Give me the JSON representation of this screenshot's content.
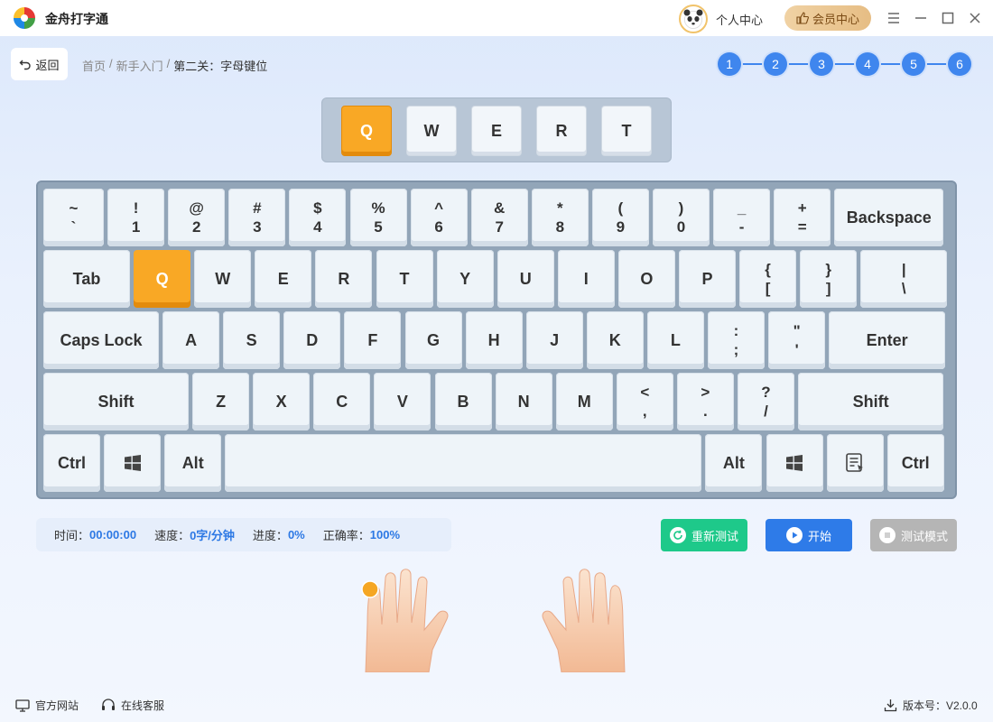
{
  "app": {
    "title": "金舟打字通"
  },
  "header": {
    "personal_center": "个人中心",
    "vip_center": "会员中心"
  },
  "nav": {
    "back_label": "返回",
    "breadcrumb": [
      "首页",
      "新手入门",
      "第二关：字母键位"
    ],
    "separator": "/"
  },
  "steps": [
    "1",
    "2",
    "3",
    "4",
    "5",
    "6"
  ],
  "target_keys": [
    {
      "label": "Q",
      "active": true
    },
    {
      "label": "W",
      "active": false
    },
    {
      "label": "E",
      "active": false
    },
    {
      "label": "R",
      "active": false
    },
    {
      "label": "T",
      "active": false
    }
  ],
  "keyboard": {
    "rows": [
      [
        {
          "top": "~",
          "bot": "`"
        },
        {
          "top": "!",
          "bot": "1"
        },
        {
          "top": "@",
          "bot": "2"
        },
        {
          "top": "#",
          "bot": "3"
        },
        {
          "top": "$",
          "bot": "4"
        },
        {
          "top": "%",
          "bot": "5"
        },
        {
          "top": "^",
          "bot": "6"
        },
        {
          "top": "&",
          "bot": "7"
        },
        {
          "top": "*",
          "bot": "8"
        },
        {
          "top": "(",
          "bot": "9"
        },
        {
          "top": ")",
          "bot": "0"
        },
        {
          "top": "_",
          "bot": "-"
        },
        {
          "top": "+",
          "bot": "="
        },
        {
          "label": "Backspace"
        }
      ],
      [
        {
          "label": "Tab"
        },
        {
          "label": "Q",
          "active": true
        },
        {
          "label": "W"
        },
        {
          "label": "E"
        },
        {
          "label": "R"
        },
        {
          "label": "T"
        },
        {
          "label": "Y"
        },
        {
          "label": "U"
        },
        {
          "label": "I"
        },
        {
          "label": "O"
        },
        {
          "label": "P"
        },
        {
          "top": "{",
          "bot": "["
        },
        {
          "top": "}",
          "bot": "]"
        },
        {
          "top": "|",
          "bot": "\\"
        }
      ],
      [
        {
          "label": "Caps Lock"
        },
        {
          "label": "A"
        },
        {
          "label": "S"
        },
        {
          "label": "D"
        },
        {
          "label": "F"
        },
        {
          "label": "G"
        },
        {
          "label": "H"
        },
        {
          "label": "J"
        },
        {
          "label": "K"
        },
        {
          "label": "L"
        },
        {
          "top": ":",
          "bot": ";"
        },
        {
          "top": "\"",
          "bot": "'"
        },
        {
          "label": "Enter"
        }
      ],
      [
        {
          "label": "Shift"
        },
        {
          "label": "Z"
        },
        {
          "label": "X"
        },
        {
          "label": "C"
        },
        {
          "label": "V"
        },
        {
          "label": "B"
        },
        {
          "label": "N"
        },
        {
          "label": "M"
        },
        {
          "top": "<",
          "bot": ","
        },
        {
          "top": ">",
          "bot": "."
        },
        {
          "top": "?",
          "bot": "/"
        },
        {
          "label": "Shift"
        }
      ],
      [
        {
          "label": "Ctrl"
        },
        {
          "icon": "windows-icon"
        },
        {
          "label": "Alt"
        },
        {
          "label": ""
        },
        {
          "label": "Alt"
        },
        {
          "icon": "windows-icon"
        },
        {
          "icon": "menu-key-icon"
        },
        {
          "label": "Ctrl"
        }
      ]
    ]
  },
  "stats": {
    "time_label": "时间：",
    "time_value": "00:00:00",
    "speed_label": "速度：",
    "speed_value": "0字/分钟",
    "progress_label": "进度：",
    "progress_value": "0%",
    "accuracy_label": "正确率：",
    "accuracy_value": "100%"
  },
  "actions": {
    "retest": "重新测试",
    "start": "开始",
    "test_mode": "测试模式"
  },
  "colors": {
    "accent": "#3f86ee",
    "active_key": "#f9a825",
    "retest": "#1ec98a",
    "start": "#2e7be8",
    "disabled": "#b5b5b5"
  },
  "footer": {
    "website": "官方网站",
    "support": "在线客服",
    "version": "版本号：V2.0.0"
  }
}
